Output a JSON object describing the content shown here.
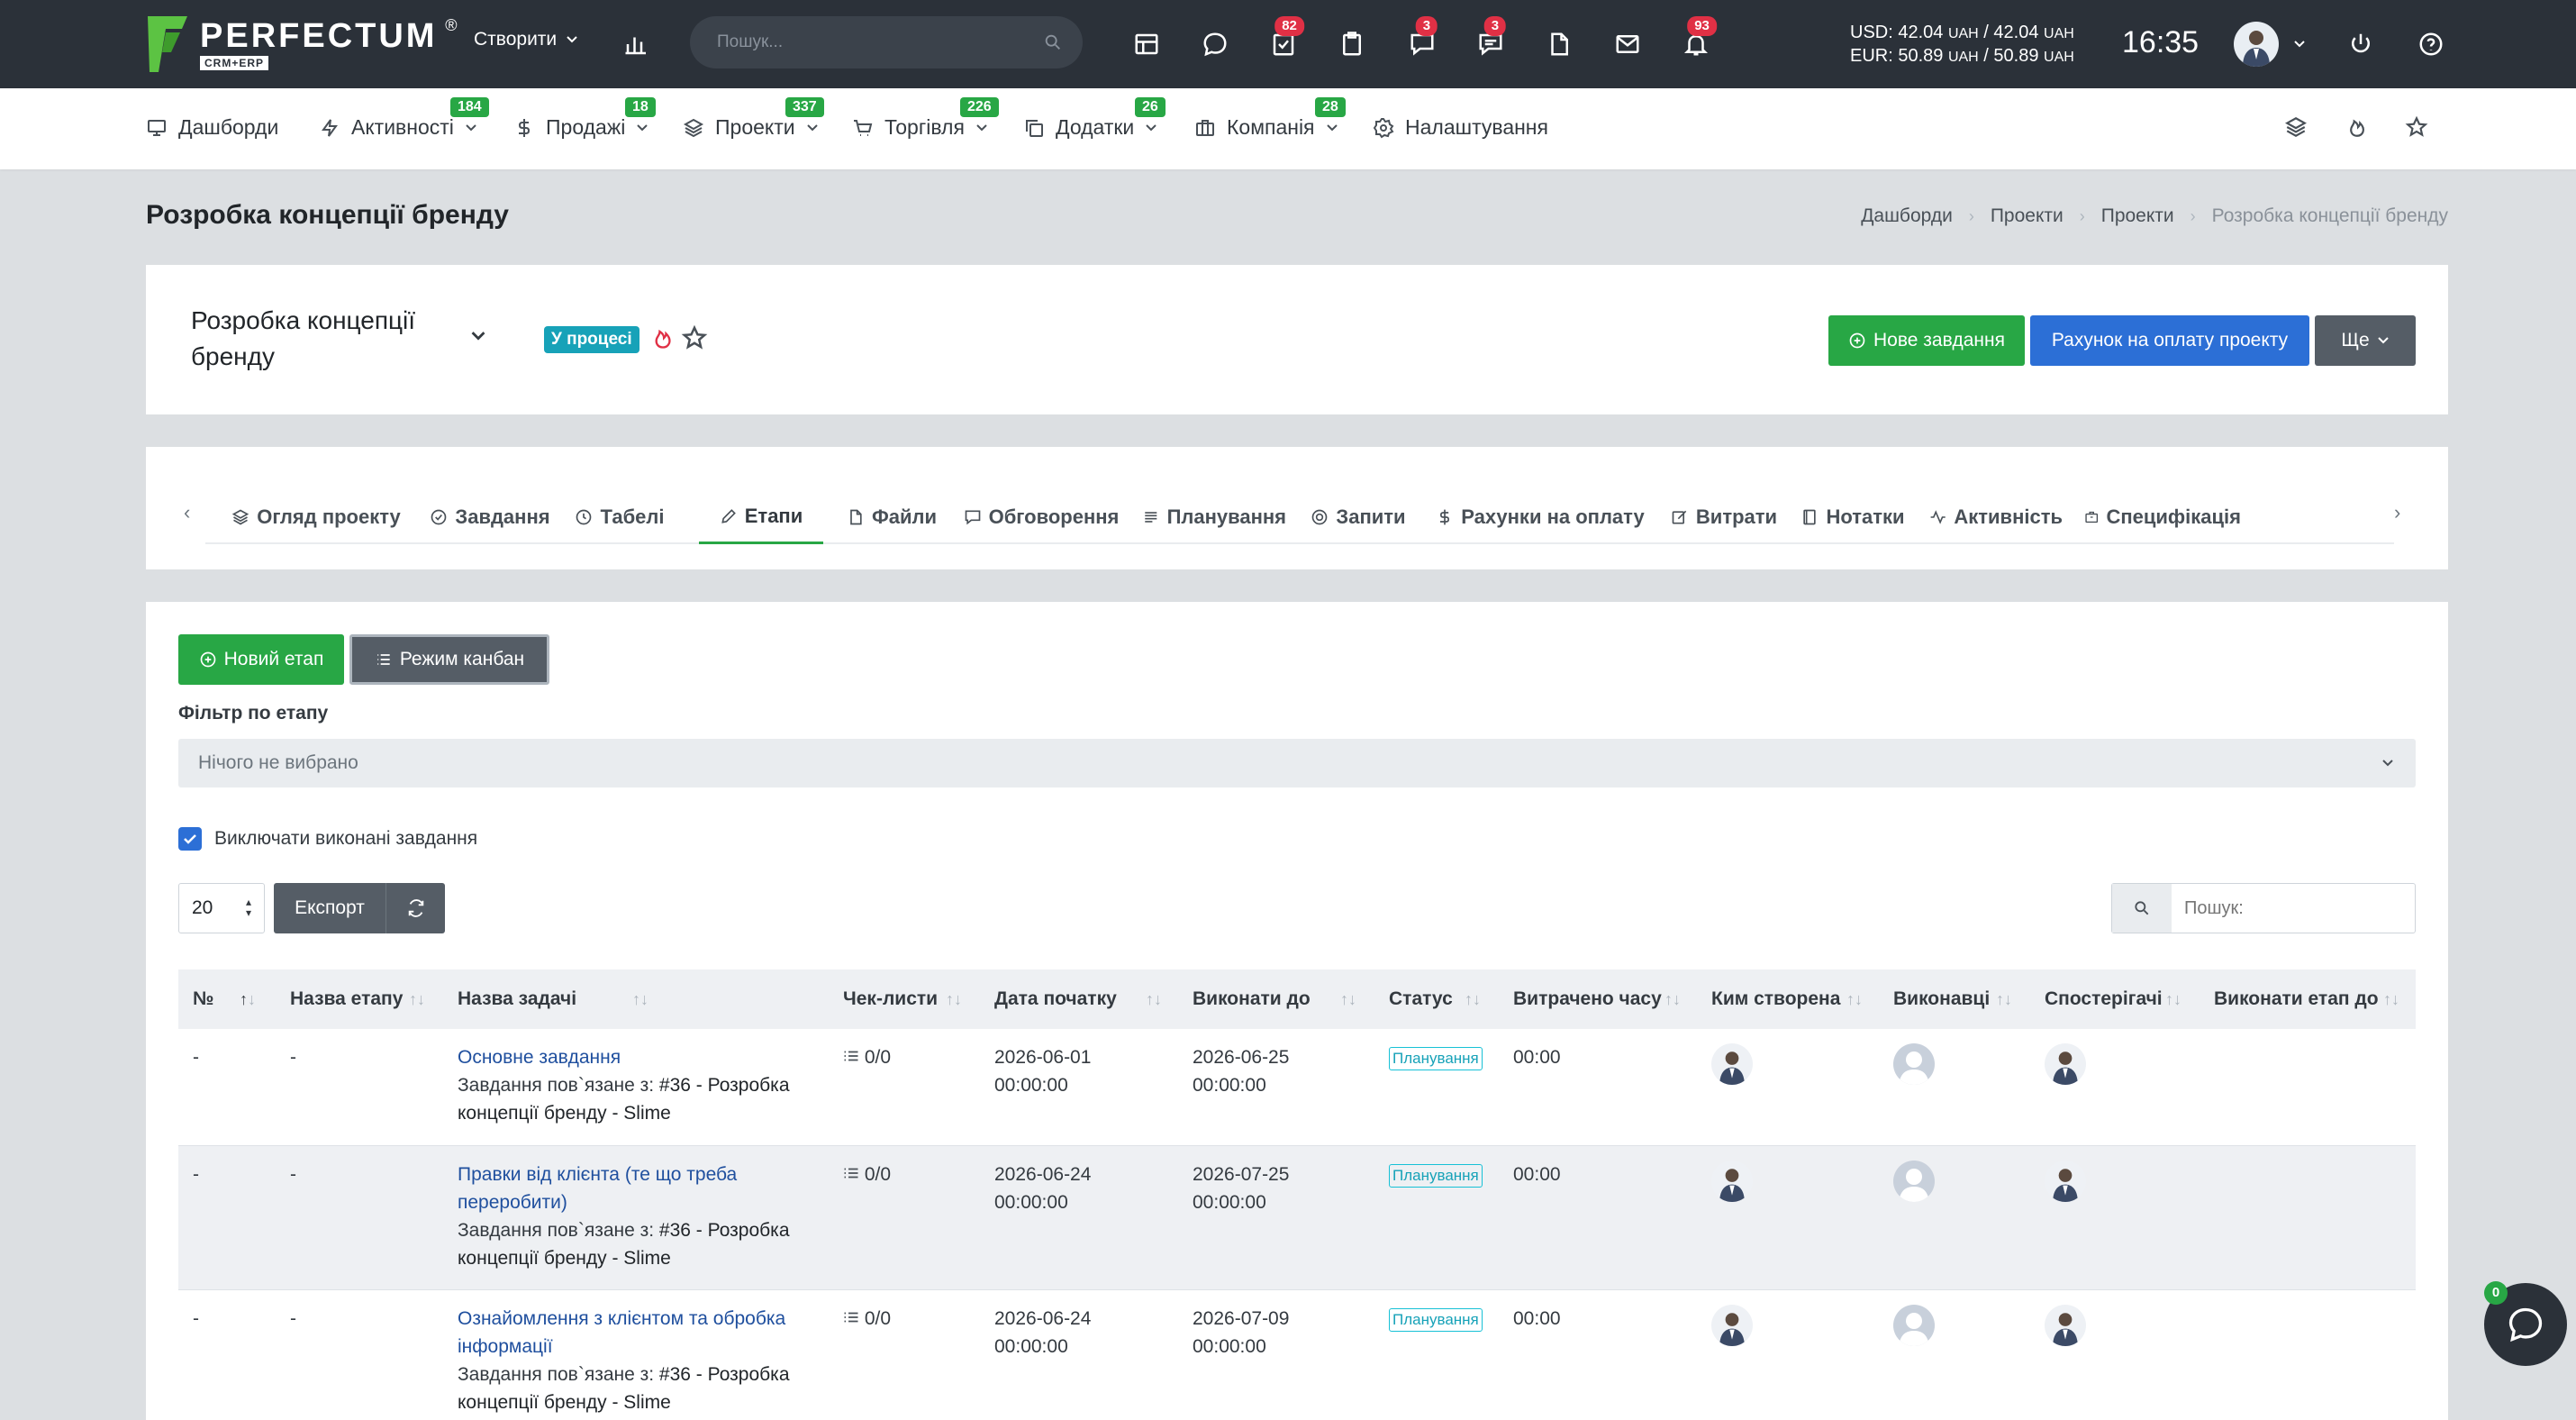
{
  "topbar": {
    "logo_text": "PERFECTUM",
    "logo_reg": "®",
    "logo_sub": "CRM+ERP",
    "create_label": "Створити",
    "search_placeholder": "Пошук...",
    "badges": {
      "tasks": "82",
      "chat": "3",
      "messages": "3",
      "notifications": "93"
    },
    "rates": {
      "usd_label": "USD: 42.04",
      "usd_unit": "UAH",
      "usd_sep": "/ 42.04",
      "usd_unit2": "UAH",
      "eur_label": "EUR: 50.89",
      "eur_unit": "UAH",
      "eur_sep": "/ 50.89",
      "eur_unit2": "UAH"
    },
    "time": "16:35"
  },
  "nav": {
    "items": [
      {
        "label": "Дашборди",
        "icon": "monitor-icon",
        "badge": ""
      },
      {
        "label": "Активності",
        "icon": "bolt-icon",
        "badge": "184"
      },
      {
        "label": "Продажі",
        "icon": "dollar-icon",
        "badge": "18"
      },
      {
        "label": "Проекти",
        "icon": "layers-icon",
        "badge": "337"
      },
      {
        "label": "Торгівля",
        "icon": "cart-icon",
        "badge": "226"
      },
      {
        "label": "Додатки",
        "icon": "copy-icon",
        "badge": "26"
      },
      {
        "label": "Компанія",
        "icon": "briefcase-icon",
        "badge": "28"
      },
      {
        "label": "Налаштування",
        "icon": "gear-icon",
        "badge": ""
      }
    ]
  },
  "page": {
    "title": "Розробка концепції бренду",
    "breadcrumb": [
      "Дашборди",
      "Проекти",
      "Проекти",
      "Розробка концепції бренду"
    ]
  },
  "project": {
    "name": "Розробка концепції бренду",
    "status": "У процесі",
    "btn_new_task": "Нове завдання",
    "btn_invoice": "Рахунок на оплату проекту",
    "btn_more": "Ще"
  },
  "tabs": [
    {
      "label": "Огляд проекту",
      "icon": "layers-icon"
    },
    {
      "label": "Завдання",
      "icon": "check-circle-icon"
    },
    {
      "label": "Табелі",
      "icon": "clock-icon"
    },
    {
      "label": "Етапи",
      "icon": "pen-icon"
    },
    {
      "label": "Файли",
      "icon": "file-icon"
    },
    {
      "label": "Обговорення",
      "icon": "comment-icon"
    },
    {
      "label": "Планування",
      "icon": "list-icon"
    },
    {
      "label": "Запити",
      "icon": "lifebuoy-icon"
    },
    {
      "label": "Рахунки на оплату",
      "icon": "dollar-icon"
    },
    {
      "label": "Витрати",
      "icon": "edit-icon"
    },
    {
      "label": "Нотатки",
      "icon": "book-icon"
    },
    {
      "label": "Активність",
      "icon": "activity-icon"
    },
    {
      "label": "Специфікація",
      "icon": "box-icon"
    }
  ],
  "stages": {
    "btn_new_stage": "Новий етап",
    "btn_kanban": "Режим канбан",
    "filter_label": "Фільтр по етапу",
    "filter_placeholder": "Нічого не вибрано",
    "exclude_done_label": "Виключати виконані завдання",
    "exclude_done": true,
    "per_page": "20",
    "export_label": "Експорт",
    "search_placeholder": "Пошук:"
  },
  "table": {
    "columns": [
      "№",
      "Назва етапу",
      "Назва задачі",
      "Чек-листи",
      "Дата початку",
      "Виконати до",
      "Статус",
      "Витрачено часу",
      "Ким створена",
      "Виконавці",
      "Спостерігачі",
      "Виконати етап до"
    ],
    "rows": [
      {
        "num": "-",
        "stage": "-",
        "task": "Основне завдання",
        "linked_prefix": "Завдання пов`язане з:",
        "linked": "#36 - Розробка концепції бренду - Slime",
        "checklist": "0/0",
        "start": "2026-06-01 00:00:00",
        "due": "2026-06-25 00:00:00",
        "status": "Планування",
        "spent": "00:00"
      },
      {
        "num": "-",
        "stage": "-",
        "task": "Правки від клієнта (те що треба переробити)",
        "linked_prefix": "Завдання пов`язане з:",
        "linked": "#36 - Розробка концепції бренду - Slime",
        "checklist": "0/0",
        "start": "2026-06-24 00:00:00",
        "due": "2026-07-25 00:00:00",
        "status": "Планування",
        "spent": "00:00"
      },
      {
        "num": "-",
        "stage": "-",
        "task": "Ознайомлення з клієнтом та обробка інформації",
        "linked_prefix": "Завдання пов`язане з:",
        "linked": "#36 - Розробка концепції бренду - Slime",
        "checklist": "0/0",
        "start": "2026-06-24 00:00:00",
        "due": "2026-07-09 00:00:00",
        "status": "Планування",
        "spent": "00:00"
      }
    ]
  },
  "chat": {
    "badge": "0"
  },
  "colors": {
    "green": "#28a745",
    "blue": "#2c6fd6",
    "dark": "#2b3139",
    "info": "#17a2b8",
    "badge_red": "#e03045"
  }
}
